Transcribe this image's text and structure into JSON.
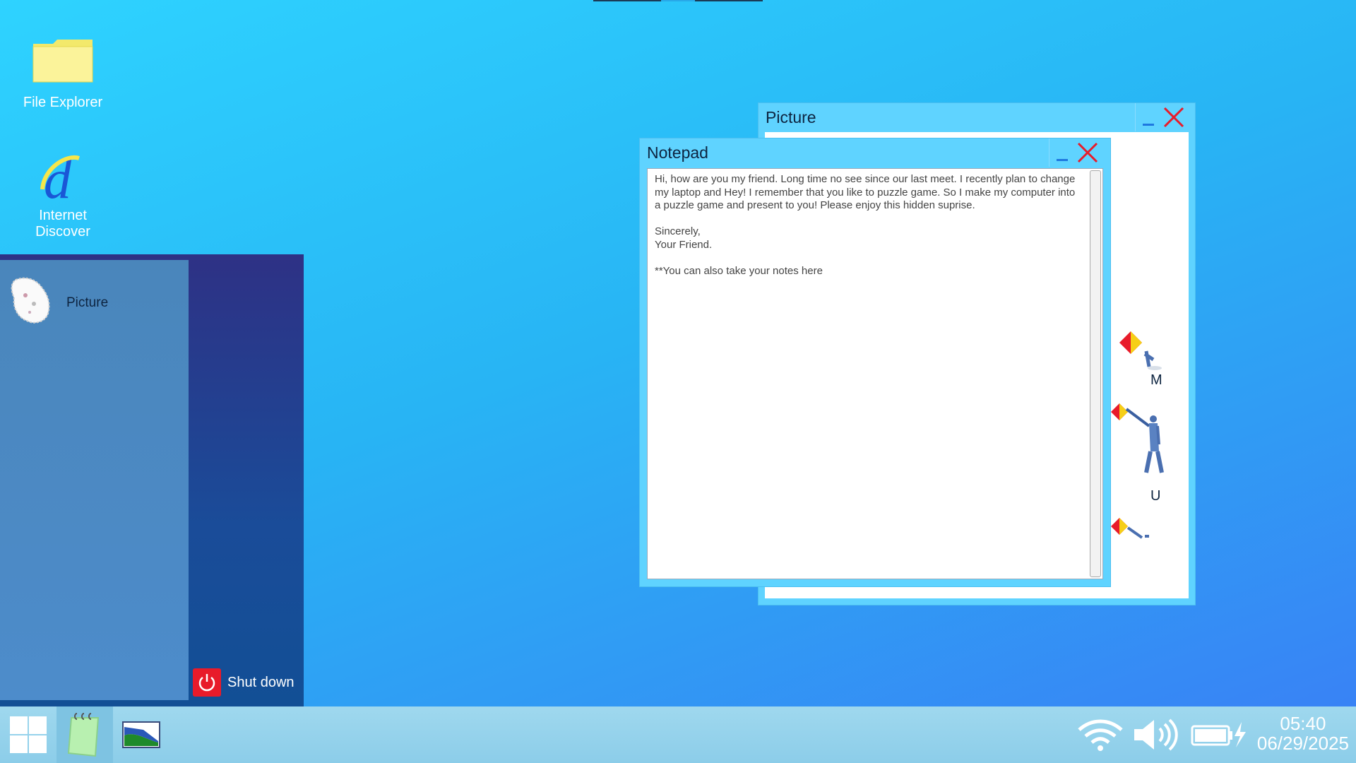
{
  "desktop": {
    "icons": [
      {
        "label": "File Explorer"
      },
      {
        "label": "Internet\nDiscover"
      }
    ]
  },
  "start_menu": {
    "items": [
      {
        "label": "Picture"
      }
    ],
    "shutdown_label": "Shut down"
  },
  "windows": {
    "picture": {
      "title": "Picture",
      "flag_letters": [
        "M",
        "U"
      ]
    },
    "notepad": {
      "title": "Notepad",
      "content": "Hi, how are you my friend. Long time no see since our last meet. I recently plan to change my laptop and Hey! I remember that you like to puzzle game. So I make my computer into a puzzle game and present to you! Please enjoy this hidden suprise.\n\nSincerely,\nYour Friend.\n\n**You can also take your notes here"
    }
  },
  "taskbar": {
    "time": "05:40",
    "date": "06/29/2025"
  },
  "colors": {
    "desktop_top": "#2ed3ff",
    "desktop_bottom": "#3a7ef5",
    "window_frame": "#5fd3ff",
    "close_red": "#e81b2a",
    "minimize_blue": "#1e78e0",
    "taskbar": "#9fd8ee"
  }
}
